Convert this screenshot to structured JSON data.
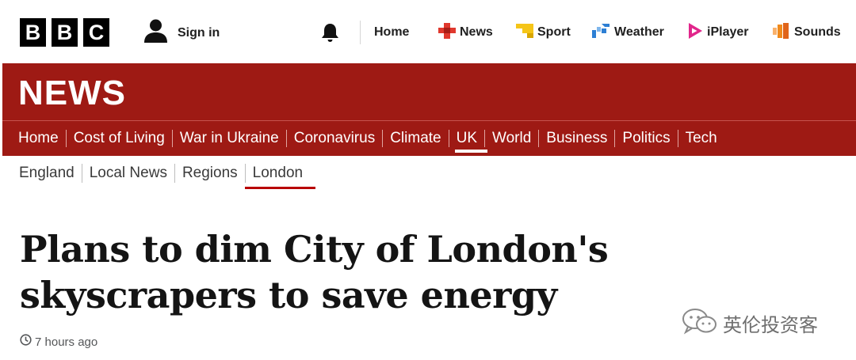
{
  "brand": {
    "logo_letters": [
      "B",
      "B",
      "C"
    ],
    "section_wordmark": "NEWS",
    "banner_color": "#9e1a14",
    "accent_underline_color": "#b80000"
  },
  "account": {
    "signin_label": "Sign in",
    "icon": "user-icon"
  },
  "notifications": {
    "icon": "bell-icon"
  },
  "top_nav": [
    {
      "label": "Home",
      "icon": null
    },
    {
      "label": "News",
      "icon": "news-icon",
      "color": "#e0382d"
    },
    {
      "label": "Sport",
      "icon": "sport-icon",
      "color": "#f5c518"
    },
    {
      "label": "Weather",
      "icon": "weather-icon",
      "color": "#2d7fd4"
    },
    {
      "label": "iPlayer",
      "icon": "iplayer-icon",
      "color": "#e1268b"
    },
    {
      "label": "Sounds",
      "icon": "sounds-icon",
      "color": "#f08a1c"
    }
  ],
  "main_nav": [
    {
      "label": "Home"
    },
    {
      "label": "Cost of Living"
    },
    {
      "label": "War in Ukraine"
    },
    {
      "label": "Coronavirus"
    },
    {
      "label": "Climate"
    },
    {
      "label": "UK",
      "active": true
    },
    {
      "label": "World"
    },
    {
      "label": "Business"
    },
    {
      "label": "Politics"
    },
    {
      "label": "Tech"
    }
  ],
  "sub_nav": [
    {
      "label": "England"
    },
    {
      "label": "Local News"
    },
    {
      "label": "Regions"
    },
    {
      "label": "London",
      "active": true
    }
  ],
  "article": {
    "headline": "Plans to dim City of London's skyscrapers to save energy",
    "timestamp": "7 hours ago",
    "timestamp_icon": "clock-icon"
  },
  "watermark": {
    "label": "英伦投资客",
    "icon": "wechat-icon"
  }
}
